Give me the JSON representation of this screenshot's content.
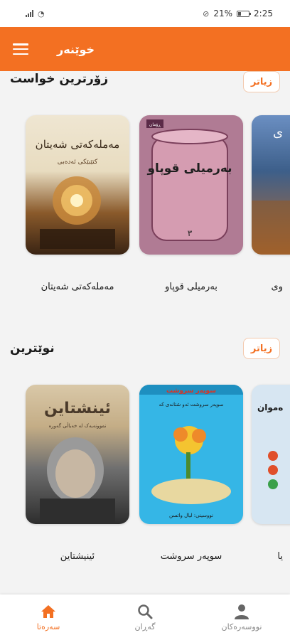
{
  "status_bar": {
    "battery": "21%",
    "time": "2:25"
  },
  "app_bar": {
    "title": "خوێنەر",
    "menu_icon": "hamburger-menu-icon"
  },
  "colors": {
    "accent": "#f37022",
    "background": "#f3f3f3"
  },
  "sections": [
    {
      "title": "زۆرترین خواست",
      "more_label": "زیاتر",
      "books": [
        {
          "title": "مەملەکەتی شەیتان",
          "cover_title": "مەملەکەتی شەیتان",
          "cover_author": "کتێبێکی ئەدەبی"
        },
        {
          "title": "بەرمیلی قوپاو",
          "cover_title": "بەرمیلی قوپاو",
          "cover_badge": "ڕۆمان",
          "cover_number": "٣"
        },
        {
          "title": "وی",
          "cover_title": "ی"
        }
      ]
    },
    {
      "title": "نوێترین",
      "more_label": "زیاتر",
      "books": [
        {
          "title": "ئینیشتاین",
          "cover_title": "ئینشتاین",
          "cover_subtitle": "نموونەیەک لە خەیاڵی گەورە"
        },
        {
          "title": "سوپەر سروشت",
          "cover_title": "سوپەر سروشت",
          "cover_subtitle": "سوپەر سروشت ئەو شتانەی کە",
          "cover_author": "نووسینی: لیال واتسن"
        },
        {
          "title": "یا",
          "cover_title": "ەموان"
        }
      ]
    }
  ],
  "bottom_nav": [
    {
      "label": "سەرەتا",
      "icon": "home-icon",
      "active": true
    },
    {
      "label": "گەڕان",
      "icon": "search-icon",
      "active": false
    },
    {
      "label": "نووسەرەکان",
      "icon": "person-icon",
      "active": false
    }
  ]
}
